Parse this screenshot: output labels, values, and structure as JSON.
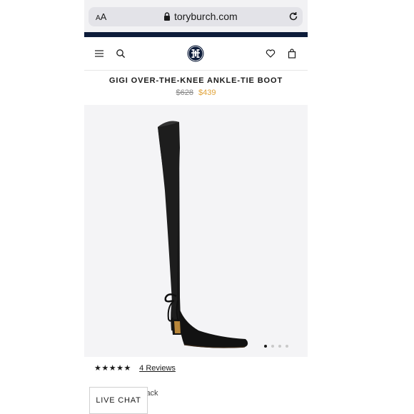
{
  "browser": {
    "text_size_label": "AA",
    "url": "toryburch.com",
    "icons": [
      "lock-icon",
      "reload-icon"
    ]
  },
  "header": {
    "icons": [
      "menu-icon",
      "search-icon",
      "tory-burch-logo",
      "heart-icon",
      "bag-icon"
    ]
  },
  "product": {
    "title": "GIGI OVER-THE-KNEE ANKLE-TIE BOOT",
    "original_price": "$628",
    "sale_price": "$439",
    "image_count": 4,
    "current_image": 1
  },
  "reviews": {
    "stars": "★★★★★",
    "rating": 4.5,
    "link_label": "4 Reviews"
  },
  "color": {
    "partial_label": "lack"
  },
  "chat": {
    "label": "LIVE CHAT"
  },
  "colors": {
    "navy": "#0d1c3a",
    "sale": "#e0a238"
  }
}
